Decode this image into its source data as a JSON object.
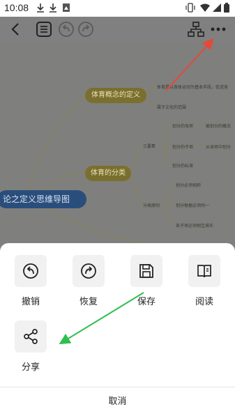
{
  "status_bar": {
    "time": "10:08",
    "icons": [
      "download-icon",
      "download-icon",
      "image-icon",
      "vibrate-icon",
      "wifi-icon",
      "signal-icon",
      "battery-icon"
    ]
  },
  "toolbar": {
    "icons": [
      "back-icon",
      "outline-icon",
      "undo-icon",
      "redo-icon",
      "structure-icon",
      "more-icon"
    ]
  },
  "mindmap": {
    "root": "论之定义思维导图",
    "branches": [
      {
        "label": "体育概念的定义",
        "leaves": [
          "体育是以身体运动为基本手段，促进身",
          "属于文化的范围"
        ]
      },
      {
        "label": "体育的分类",
        "leaves": [
          "三要素",
          "划分的母项",
          "被划分的概念",
          "划分的子项",
          "从母项中划分",
          "划分的标准",
          "分类原则",
          "划分必须相称",
          "划分根据必须同一",
          "各子项必须相互排斥"
        ]
      }
    ]
  },
  "share_sheet": {
    "actions": [
      {
        "label": "撤销",
        "icon": "undo-icon"
      },
      {
        "label": "恢复",
        "icon": "redo-icon"
      },
      {
        "label": "保存",
        "icon": "save-icon"
      },
      {
        "label": "阅读",
        "icon": "read-icon"
      },
      {
        "label": "分享",
        "icon": "share-icon"
      }
    ],
    "cancel": "取消"
  },
  "colors": {
    "arrow_red": "#e5493a",
    "arrow_green": "#2fbf4f",
    "root_node": "#2a4e7c",
    "branch_node": "#7a6f2f"
  }
}
